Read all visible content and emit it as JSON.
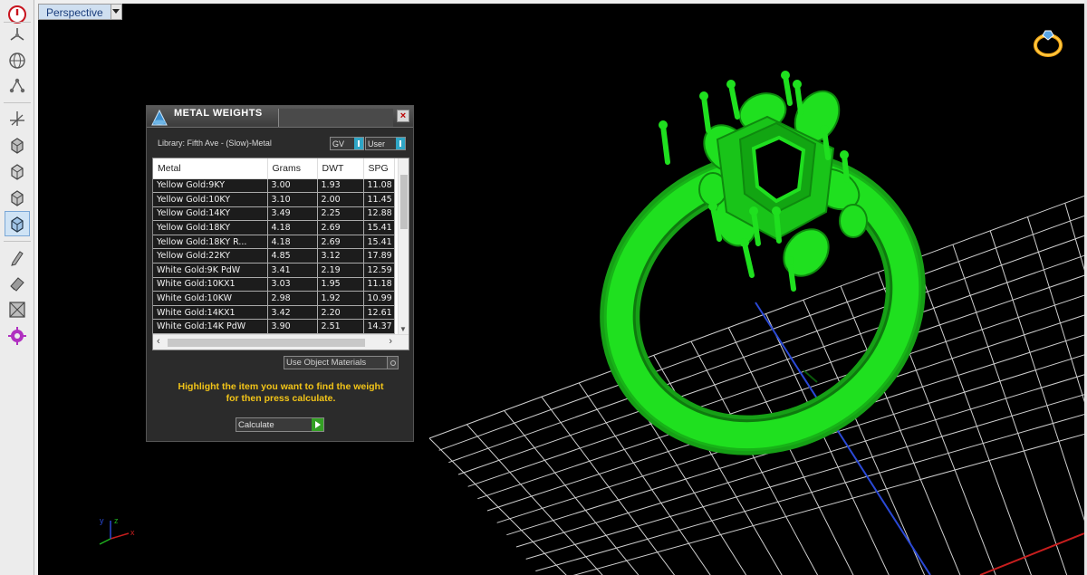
{
  "viewport": {
    "view_name": "Perspective"
  },
  "toolbar": {
    "icons": [
      "power-icon",
      "fan-icon",
      "globe-icon",
      "nodes-icon",
      "axes-icon",
      "cube-front-icon",
      "cube-top-icon",
      "cube-side-icon",
      "cube-perspective-icon",
      "pen-icon",
      "eraser-icon",
      "frame-icon",
      "gear-icon"
    ]
  },
  "dialog": {
    "title": "METAL WEIGHTS",
    "library_label": "Library: Fifth Ave - (Slow)-Metal",
    "gv_select": "GV",
    "user_select": "User",
    "columns": [
      "Metal",
      "Grams",
      "DWT",
      "SPG"
    ],
    "rows": [
      [
        "Yellow Gold:9KY",
        "3.00",
        "1.93",
        "11.08"
      ],
      [
        "Yellow Gold:10KY",
        "3.10",
        "2.00",
        "11.45"
      ],
      [
        "Yellow Gold:14KY",
        "3.49",
        "2.25",
        "12.88"
      ],
      [
        "Yellow Gold:18KY",
        "4.18",
        "2.69",
        "15.41"
      ],
      [
        "Yellow Gold:18KY R...",
        "4.18",
        "2.69",
        "15.41"
      ],
      [
        "Yellow Gold:22KY",
        "4.85",
        "3.12",
        "17.89"
      ],
      [
        "White Gold:9K PdW",
        "3.41",
        "2.19",
        "12.59"
      ],
      [
        "White Gold:10KX1",
        "3.03",
        "1.95",
        "11.18"
      ],
      [
        "White Gold:10KW",
        "2.98",
        "1.92",
        "10.99"
      ],
      [
        "White Gold:14KX1",
        "3.42",
        "2.20",
        "12.61"
      ],
      [
        "White Gold:14K PdW",
        "3.90",
        "2.51",
        "14.37"
      ]
    ],
    "use_object_materials": "Use Object Materials",
    "hint_line1": "Highlight the item you want to find the weight",
    "hint_line2": "for then press calculate.",
    "calculate_label": "Calculate"
  },
  "gizmo": {
    "x": "x",
    "y": "y",
    "z": "z"
  },
  "colors": {
    "ring_green": "#1fe01f",
    "hint_yellow": "#f2c418",
    "grid_line": "#cfcfcf",
    "axis_blue": "#2a49d6",
    "axis_red": "#c81e1e"
  }
}
